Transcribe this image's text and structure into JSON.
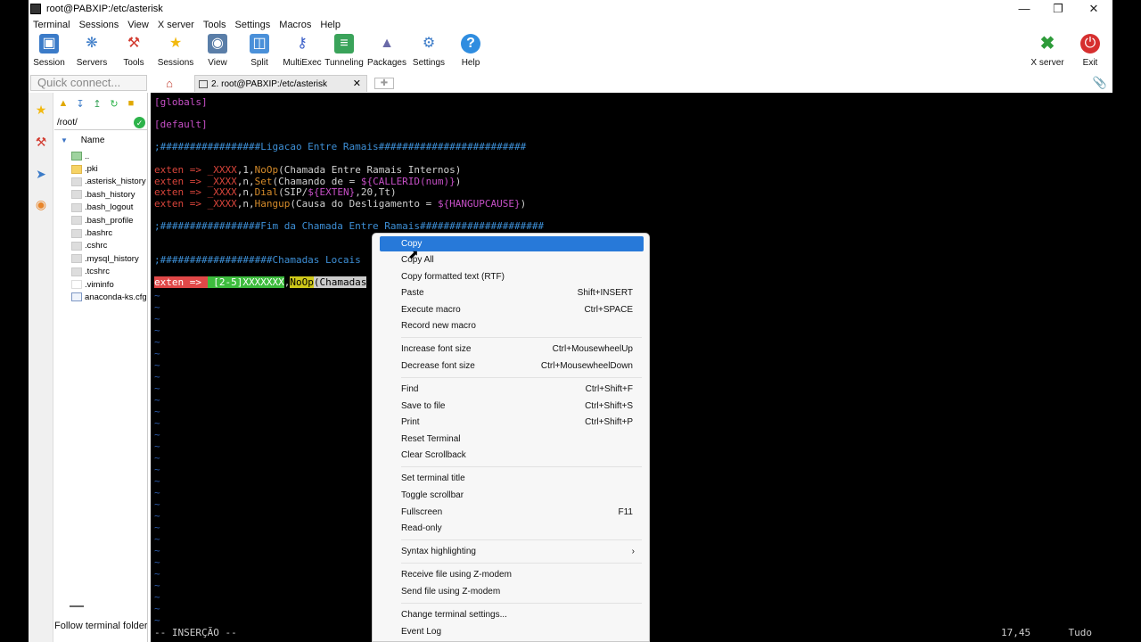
{
  "window": {
    "title": "root@PABXIP:/etc/asterisk"
  },
  "menubar": [
    "Terminal",
    "Sessions",
    "View",
    "X server",
    "Tools",
    "Settings",
    "Macros",
    "Help"
  ],
  "toolbar": {
    "session": "Session",
    "servers": "Servers",
    "tools": "Tools",
    "sessions": "Sessions",
    "view": "View",
    "split": "Split",
    "multiexec": "MultiExec",
    "tunneling": "Tunneling",
    "packages": "Packages",
    "settings": "Settings",
    "help": "Help",
    "xserver": "X server",
    "exit": "Exit"
  },
  "quick_connect": {
    "placeholder": "Quick connect..."
  },
  "tab": {
    "label": "2. root@PABXIP:/etc/asterisk"
  },
  "sidebar": {
    "path": "/root/",
    "column_name": "Name",
    "files": [
      "..",
      ".pki",
      ".asterisk_history",
      ".bash_history",
      ".bash_logout",
      ".bash_profile",
      ".bashrc",
      ".cshrc",
      ".mysql_history",
      ".tcshrc",
      ".viminfo",
      "anaconda-ks.cfg"
    ],
    "follow_label": "Follow terminal folder"
  },
  "terminal": {
    "globals": "[globals]",
    "default": "[default]",
    "comment1": ";#################Ligacao Entre Ramais#########################",
    "l1_a": "exten => ",
    "l1_b": "_XXXX",
    "l1_c": ",1,",
    "l1_d": "NoOp",
    "l1_e": "(Chamada Entre Ramais Internos)",
    "l2_a": "exten => ",
    "l2_b": "_XXXX",
    "l2_c": ",n,",
    "l2_d": "Set",
    "l2_e": "(Chamando de = ",
    "l2_f": "${CALLERID(num)}",
    "l2_g": ")",
    "l3_a": "exten => ",
    "l3_b": "_XXXX",
    "l3_c": ",n,",
    "l3_d": "Dial",
    "l3_e": "(SIP/",
    "l3_f": "${EXTEN}",
    "l3_g": ",20,",
    "l3_h": "Tt)",
    "l4_a": "exten => ",
    "l4_b": "_XXXX",
    "l4_c": ",n,",
    "l4_d": "Hangup",
    "l4_e": "(Causa do Desligamento = ",
    "l4_f": "${HANGUPCAUSE}",
    "l4_g": ")",
    "comment2": ";#################Fim da Chamada Entre Ramais#####################",
    "comment3": ";###################Chamadas Locais",
    "l5_a": "exten => ",
    "l5_b": " [2-5]XXXXXXX",
    "l5_c": ",",
    "l5_d": "NoOp",
    "l5_e": "(Chamadas",
    "status_mode": "-- INSERÇÃO --",
    "status_pos": "17,45",
    "status_pct": "Tudo"
  },
  "context_menu": {
    "copy": "Copy",
    "copy_all": "Copy All",
    "copy_rtf": "Copy formatted text (RTF)",
    "paste": "Paste",
    "paste_sc": "Shift+INSERT",
    "exec_macro": "Execute macro",
    "exec_macro_sc": "Ctrl+SPACE",
    "record_macro": "Record new macro",
    "inc_font": "Increase font size",
    "inc_font_sc": "Ctrl+MousewheelUp",
    "dec_font": "Decrease font size",
    "dec_font_sc": "Ctrl+MousewheelDown",
    "find": "Find",
    "find_sc": "Ctrl+Shift+F",
    "save": "Save to file",
    "save_sc": "Ctrl+Shift+S",
    "print": "Print",
    "print_sc": "Ctrl+Shift+P",
    "reset": "Reset Terminal",
    "clear": "Clear Scrollback",
    "set_title": "Set terminal title",
    "toggle_scroll": "Toggle scrollbar",
    "fullscreen": "Fullscreen",
    "fullscreen_sc": "F11",
    "readonly": "Read-only",
    "syntax": "Syntax highlighting",
    "receive": "Receive file using Z-modem",
    "send": "Send file using Z-modem",
    "change_settings": "Change terminal settings...",
    "event_log": "Event Log"
  },
  "colors": {
    "accent": "#2779d9",
    "terminal_bg": "#000000"
  }
}
